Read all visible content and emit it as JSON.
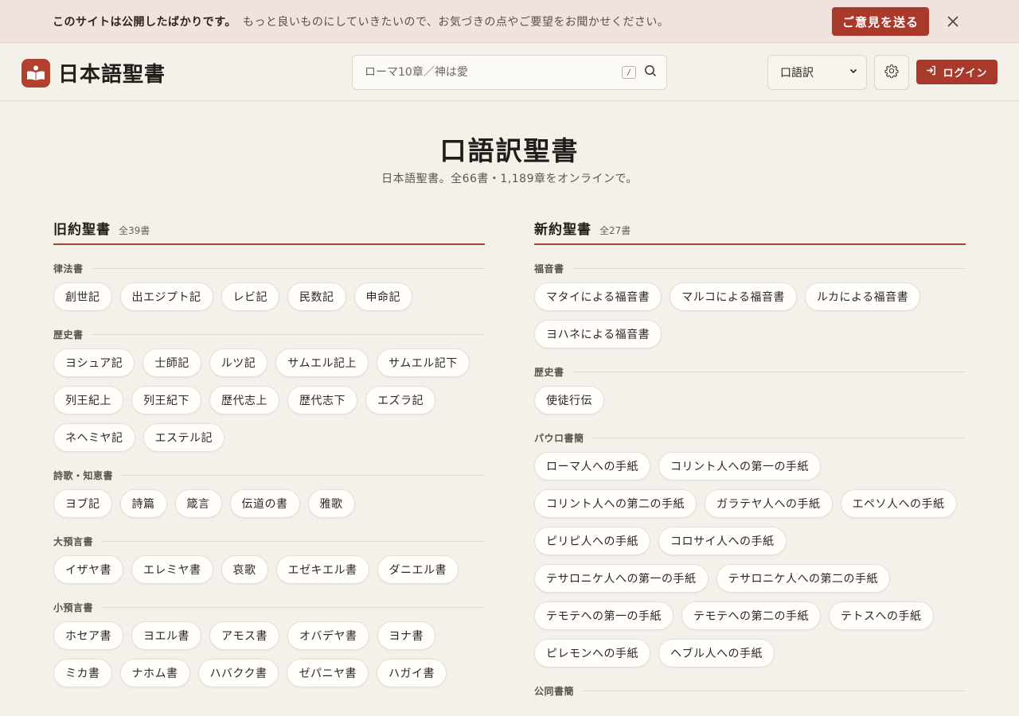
{
  "banner": {
    "title": "このサイトは公開したばかりです。",
    "message": "もっと良いものにしていきたいので、お気づきの点やご要望をお聞かせください。",
    "feedback_label": "ご意見を送る"
  },
  "header": {
    "app_title": "日本語聖書",
    "search_placeholder": "ローマ10章／神は愛",
    "search_shortcut": "/",
    "version_selected": "口語訳",
    "login_label": "ログイン"
  },
  "main": {
    "title": "口語訳聖書",
    "subtitle": "日本語聖書。全66書・1,189章をオンラインで。"
  },
  "old_testament": {
    "title": "旧約聖書",
    "count": "全39書",
    "categories": [
      {
        "name": "律法書",
        "books": [
          "創世記",
          "出エジプト記",
          "レビ記",
          "民数記",
          "申命記"
        ]
      },
      {
        "name": "歴史書",
        "books": [
          "ヨシュア記",
          "士師記",
          "ルツ記",
          "サムエル記上",
          "サムエル記下",
          "列王紀上",
          "列王紀下",
          "歴代志上",
          "歴代志下",
          "エズラ記",
          "ネヘミヤ記",
          "エステル記"
        ]
      },
      {
        "name": "詩歌・知恵書",
        "books": [
          "ヨブ記",
          "詩篇",
          "箴言",
          "伝道の書",
          "雅歌"
        ]
      },
      {
        "name": "大預言書",
        "books": [
          "イザヤ書",
          "エレミヤ書",
          "哀歌",
          "エゼキエル書",
          "ダニエル書"
        ]
      },
      {
        "name": "小預言書",
        "books": [
          "ホセア書",
          "ヨエル書",
          "アモス書",
          "オバデヤ書",
          "ヨナ書",
          "ミカ書",
          "ナホム書",
          "ハバクク書",
          "ゼパニヤ書",
          "ハガイ書"
        ]
      }
    ]
  },
  "new_testament": {
    "title": "新約聖書",
    "count": "全27書",
    "categories": [
      {
        "name": "福音書",
        "books": [
          "マタイによる福音書",
          "マルコによる福音書",
          "ルカによる福音書",
          "ヨハネによる福音書"
        ]
      },
      {
        "name": "歴史書",
        "books": [
          "使徒行伝"
        ]
      },
      {
        "name": "パウロ書簡",
        "books": [
          "ローマ人への手紙",
          "コリント人への第一の手紙",
          "コリント人への第二の手紙",
          "ガラテヤ人への手紙",
          "エペソ人への手紙",
          "ピリピ人への手紙",
          "コロサイ人への手紙",
          "テサロニケ人への第一の手紙",
          "テサロニケ人への第二の手紙",
          "テモテへの第一の手紙",
          "テモテへの第二の手紙",
          "テトスへの手紙",
          "ピレモンへの手紙",
          "ヘブル人への手紙"
        ]
      },
      {
        "name": "公同書簡",
        "books": []
      }
    ]
  },
  "colors": {
    "accent": "#a8392b",
    "banner_bg": "#f1e2de",
    "page_bg": "#f3f1ea"
  }
}
